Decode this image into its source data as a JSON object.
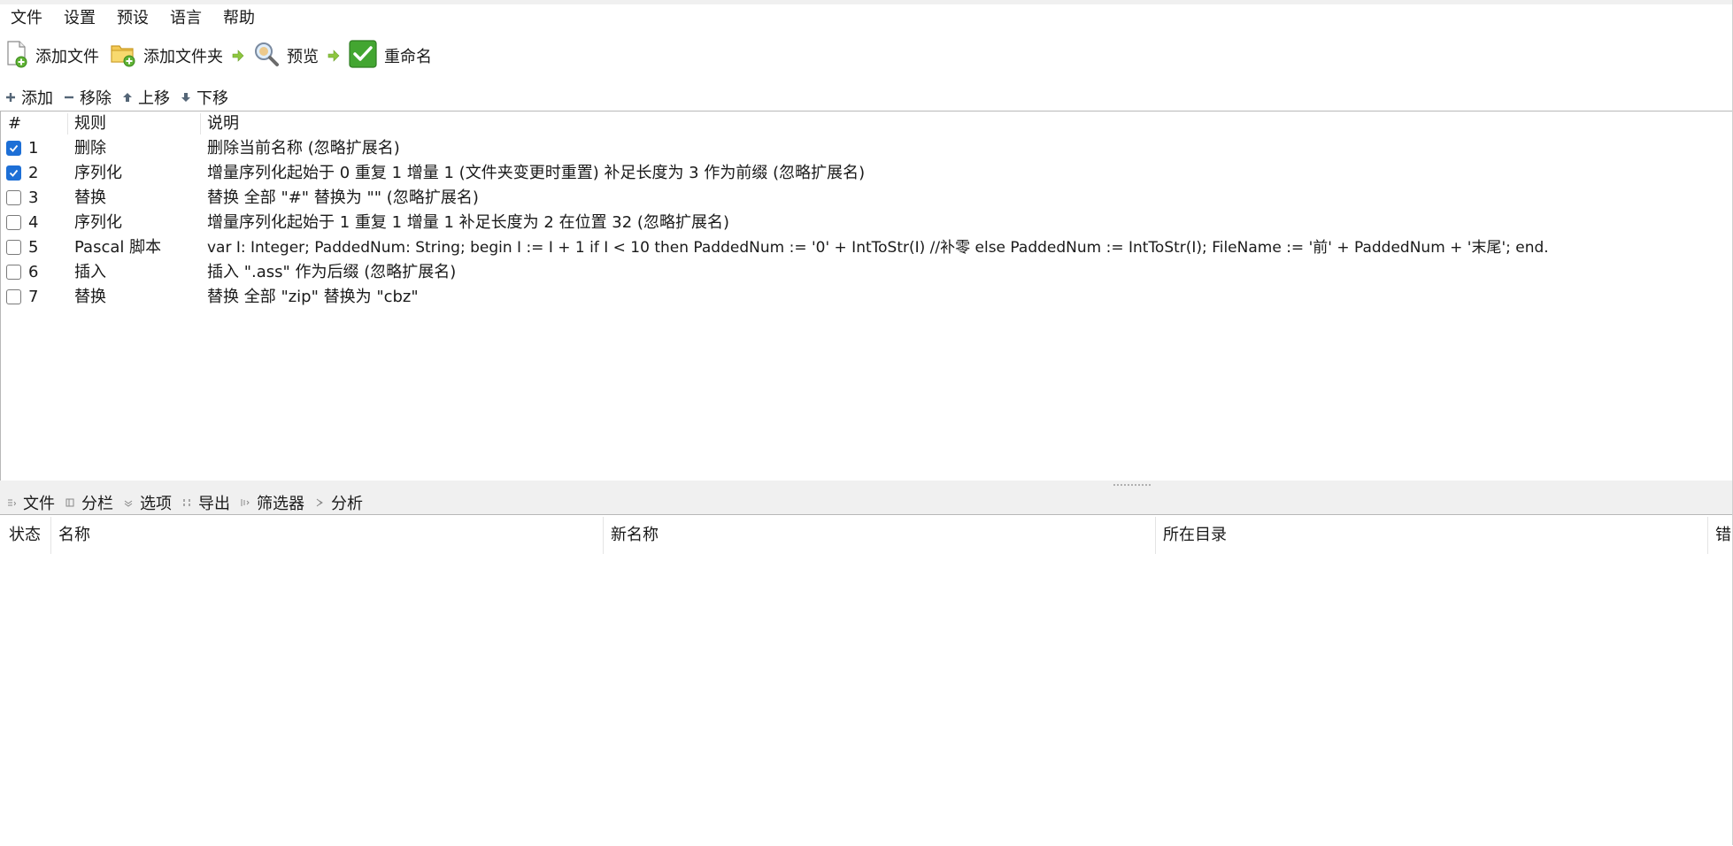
{
  "menubar": {
    "items": [
      "文件",
      "设置",
      "预设",
      "语言",
      "帮助"
    ]
  },
  "toolbar": {
    "add_files": "添加文件",
    "add_folders": "添加文件夹",
    "preview": "预览",
    "rename": "重命名"
  },
  "rules_toolbar": {
    "add": "添加",
    "remove": "移除",
    "move_up": "上移",
    "move_down": "下移"
  },
  "rules_table": {
    "columns": [
      "#",
      "规则",
      "说明"
    ],
    "rows": [
      {
        "checked": true,
        "index": "1",
        "rule": "删除",
        "description": "删除当前名称 (忽略扩展名)"
      },
      {
        "checked": true,
        "index": "2",
        "rule": "序列化",
        "description": "增量序列化起始于 0 重复 1 增量 1 (文件夹变更时重置) 补足长度为 3 作为前缀 (忽略扩展名)"
      },
      {
        "checked": false,
        "index": "3",
        "rule": "替换",
        "description": "替换 全部 \"#\" 替换为 \"\" (忽略扩展名)"
      },
      {
        "checked": false,
        "index": "4",
        "rule": "序列化",
        "description": "增量序列化起始于 1 重复 1 增量 1 补足长度为 2 在位置 32 (忽略扩展名)"
      },
      {
        "checked": false,
        "index": "5",
        "rule": "Pascal 脚本",
        "description": "var I: Integer; PaddedNum: String; begin I := I + 1 if I < 10 then PaddedNum := '0' + IntToStr(I) //补零 else PaddedNum := IntToStr(I); FileName := '前' + PaddedNum + '末尾'; end."
      },
      {
        "checked": false,
        "index": "6",
        "rule": "插入",
        "description": "插入 \".ass\" 作为后缀 (忽略扩展名)"
      },
      {
        "checked": false,
        "index": "7",
        "rule": "替换",
        "description": "替换 全部 \"zip\" 替换为 \"cbz\""
      }
    ]
  },
  "files_toolbar": {
    "files": "文件",
    "columns": "分栏",
    "options": "选项",
    "export": "导出",
    "filter": "筛选器",
    "analyze": "分析"
  },
  "files_table": {
    "columns": [
      "状态",
      "名称",
      "新名称",
      "所在目录",
      "错"
    ]
  },
  "colors": {
    "checkbox_checked": "#1d6fd6",
    "arrow_green": "#8dc63f",
    "rename_green": "#43a631"
  }
}
